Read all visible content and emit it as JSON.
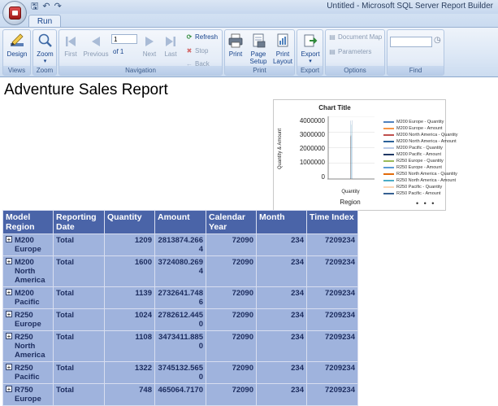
{
  "window": {
    "title": "Untitled - Microsoft SQL Server Report Builder"
  },
  "ribbon": {
    "active_tab": "Run",
    "groups": {
      "views": {
        "label": "Views",
        "design": "Design"
      },
      "zoom": {
        "label": "Zoom",
        "zoom": "Zoom"
      },
      "navigation": {
        "label": "Navigation",
        "first": "First",
        "previous": "Previous",
        "page_value": "1",
        "of_text": "of  1",
        "next": "Next",
        "last": "Last",
        "refresh": "Refresh",
        "stop": "Stop",
        "back": "Back"
      },
      "print": {
        "label": "Print",
        "print": "Print",
        "page_setup": "Page Setup",
        "print_layout": "Print Layout"
      },
      "export": {
        "label": "Export",
        "export": "Export"
      },
      "options": {
        "label": "Options",
        "document_map": "Document Map",
        "parameters": "Parameters"
      },
      "find": {
        "label": "Find",
        "find_value": ""
      }
    }
  },
  "report": {
    "title": "Adventure Sales Report"
  },
  "chart": {
    "title": "Chart Title",
    "y_axis_label": "Quantity & Amount",
    "y_ticks": [
      "4000000",
      "3000000",
      "2000000",
      "1000000",
      "0"
    ],
    "x_tick": "Quantity",
    "x_axis_label": "Region",
    "legend_more": "• • •"
  },
  "chart_data": {
    "type": "bar",
    "title": "Chart Title",
    "xlabel": "Region",
    "ylabel": "Quantity & Amount",
    "ylim": [
      0,
      4000000
    ],
    "categories": [
      "Quantity"
    ],
    "grid": true,
    "legend_position": "right",
    "series": [
      {
        "name": "M200 Europe - Quantity",
        "color": "#4f81bd",
        "values": [
          1209
        ]
      },
      {
        "name": "M200 Europe - Amount",
        "color": "#f79646",
        "values": [
          2813874.2664
        ]
      },
      {
        "name": "M200 North America - Quantity",
        "color": "#c0504d",
        "values": [
          1600
        ]
      },
      {
        "name": "M200 North America - Amount",
        "color": "#2a6099",
        "values": [
          3724080.2694
        ]
      },
      {
        "name": "M200 Pacific - Quantity",
        "color": "#b9c9e6",
        "values": [
          1139
        ]
      },
      {
        "name": "M200 Pacific - Amount",
        "color": "#1f3864",
        "values": [
          2732641.7486
        ]
      },
      {
        "name": "R250 Europe - Quantity",
        "color": "#9bbb59",
        "values": [
          1024
        ]
      },
      {
        "name": "R250 Europe - Amount",
        "color": "#5b9bd5",
        "values": [
          2782612.445
        ]
      },
      {
        "name": "R250 North America - Quantity",
        "color": "#e26b0a",
        "values": [
          1108
        ]
      },
      {
        "name": "R250 North America - Amount",
        "color": "#4bacc6",
        "values": [
          3473411.885
        ]
      },
      {
        "name": "R250 Pacific - Quantity",
        "color": "#fcd5b4",
        "values": [
          1322
        ]
      },
      {
        "name": "R250 Pacific - Amount",
        "color": "#366092",
        "values": [
          3745132.565
        ]
      }
    ]
  },
  "table": {
    "headers": [
      "Model Region",
      "Reporting Date",
      "Quantity",
      "Amount",
      "Calendar Year",
      "Month",
      "Time Index"
    ],
    "rows": [
      {
        "region": "M200 Europe",
        "date": "Total",
        "quantity": "1209",
        "amount": "2813874.2664",
        "year": "72090",
        "month": "234",
        "time_index": "7209234"
      },
      {
        "region": "M200 North America",
        "date": "Total",
        "quantity": "1600",
        "amount": "3724080.2694",
        "year": "72090",
        "month": "234",
        "time_index": "7209234"
      },
      {
        "region": "M200 Pacific",
        "date": "Total",
        "quantity": "1139",
        "amount": "2732641.7486",
        "year": "72090",
        "month": "234",
        "time_index": "7209234"
      },
      {
        "region": "R250 Europe",
        "date": "Total",
        "quantity": "1024",
        "amount": "2782612.4450",
        "year": "72090",
        "month": "234",
        "time_index": "7209234"
      },
      {
        "region": "R250 North America",
        "date": "Total",
        "quantity": "1108",
        "amount": "3473411.8850",
        "year": "72090",
        "month": "234",
        "time_index": "7209234"
      },
      {
        "region": "R250 Pacific",
        "date": "Total",
        "quantity": "1322",
        "amount": "3745132.5650",
        "year": "72090",
        "month": "234",
        "time_index": "7209234"
      },
      {
        "region": "R750 Europe",
        "date": "Total",
        "quantity": "748",
        "amount": "465064.7170",
        "year": "72090",
        "month": "234",
        "time_index": "7209234"
      }
    ]
  }
}
